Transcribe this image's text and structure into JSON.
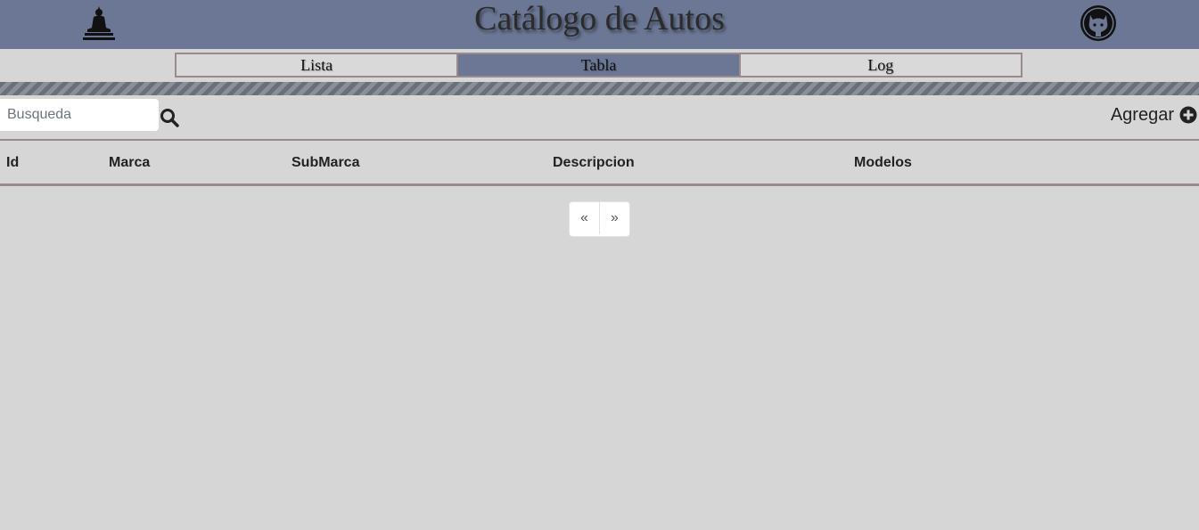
{
  "header": {
    "title": "Catálogo de Autos",
    "left_icon": "buddha-icon",
    "right_icon": "github-icon",
    "background": "#6b7795"
  },
  "tabs": [
    {
      "label": "Lista",
      "active": false
    },
    {
      "label": "Tabla",
      "active": true
    },
    {
      "label": "Log",
      "active": false
    }
  ],
  "search": {
    "placeholder": "Busqueda",
    "value": "",
    "icon": "search-icon"
  },
  "add": {
    "label": "Agregar",
    "icon": "plus-circle-icon"
  },
  "table": {
    "columns": [
      "Id",
      "Marca",
      "SubMarca",
      "Descripcion",
      "Modelos"
    ],
    "rows": []
  },
  "pagination": {
    "prev": "«",
    "next": "»"
  }
}
